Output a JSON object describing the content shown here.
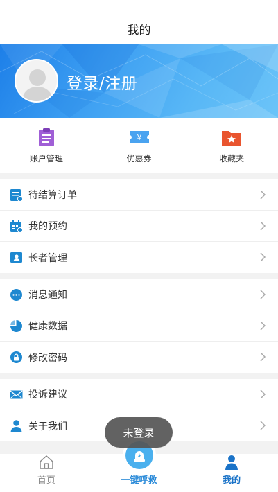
{
  "header": {
    "title": "我的"
  },
  "profile": {
    "login_label": "登录/注册"
  },
  "quick_actions": [
    {
      "label": "账户管理",
      "icon": "clipboard-icon",
      "color": "#a05fd6"
    },
    {
      "label": "优惠券",
      "icon": "coupon-icon",
      "color": "#4aa3f0"
    },
    {
      "label": "收藏夹",
      "icon": "folder-star-icon",
      "color": "#e9552f"
    }
  ],
  "menu_groups": [
    {
      "items": [
        {
          "label": "待结算订单",
          "icon": "order-icon"
        },
        {
          "label": "我的预约",
          "icon": "calendar-icon"
        },
        {
          "label": "长者管理",
          "icon": "contact-card-icon"
        }
      ]
    },
    {
      "items": [
        {
          "label": "消息通知",
          "icon": "chat-bubble-icon"
        },
        {
          "label": "健康数据",
          "icon": "pie-chart-icon"
        },
        {
          "label": "修改密码",
          "icon": "lock-icon"
        }
      ]
    },
    {
      "items": [
        {
          "label": "投诉建议",
          "icon": "envelope-icon"
        },
        {
          "label": "关于我们",
          "icon": "person-icon"
        }
      ]
    }
  ],
  "tabbar": {
    "home": "首页",
    "call": "一键呼救",
    "me": "我的"
  },
  "toast": "未登录",
  "colors": {
    "accent": "#1a73c8",
    "icon_blue": "#1e88d0"
  }
}
